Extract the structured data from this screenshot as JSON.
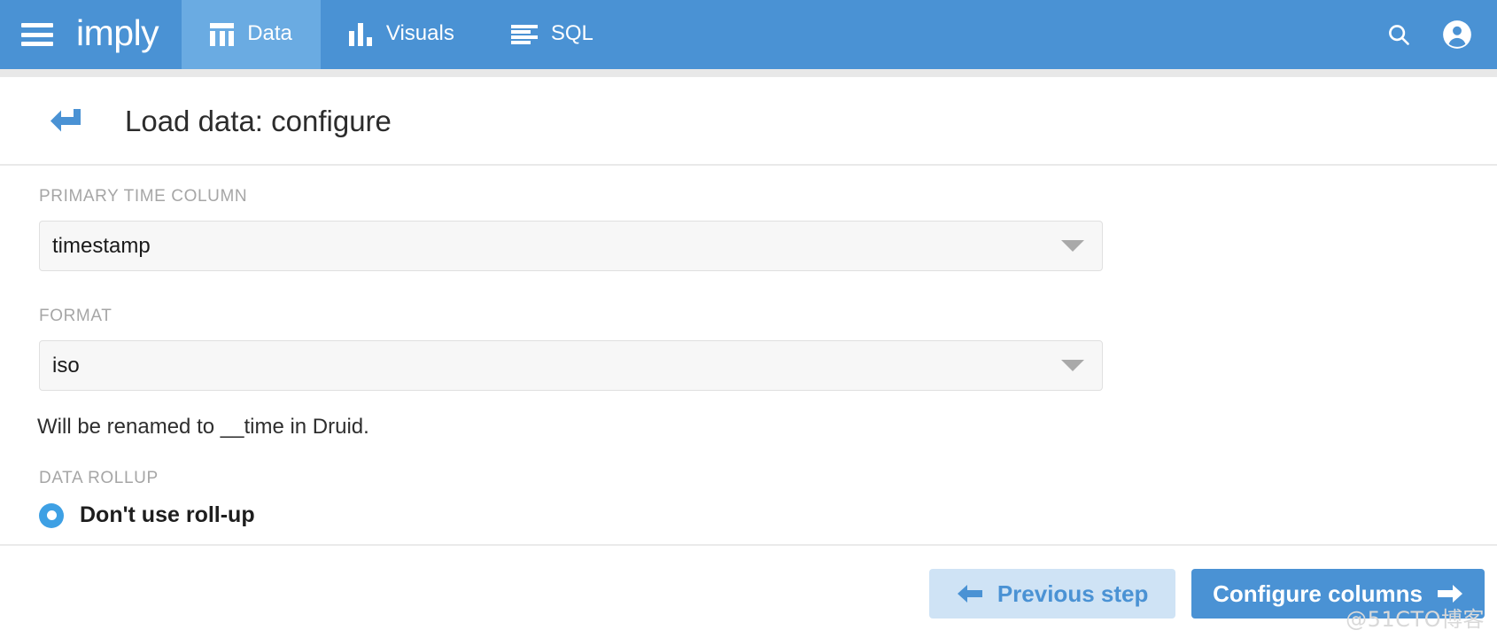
{
  "topbar": {
    "menu_icon": "hamburger-menu-icon",
    "brand": "imply",
    "tabs": [
      {
        "label": "Data",
        "icon": "table-columns-icon",
        "active": true
      },
      {
        "label": "Visuals",
        "icon": "bar-chart-icon",
        "active": false
      },
      {
        "label": "SQL",
        "icon": "text-lines-icon",
        "active": false
      }
    ],
    "actions": [
      {
        "name": "search-icon",
        "label": "Search"
      },
      {
        "name": "account-icon",
        "label": "Account"
      }
    ],
    "background_color": "#4a92d4",
    "active_tab_color": "#6aabe2"
  },
  "page": {
    "back_icon": "back-arrow-icon",
    "title": "Load data: configure"
  },
  "form": {
    "primary_time_column": {
      "label": "PRIMARY TIME COLUMN",
      "value": "timestamp",
      "caret_icon": "chevron-down-icon"
    },
    "format": {
      "label": "FORMAT",
      "value": "iso",
      "caret_icon": "chevron-down-icon"
    },
    "helper_text": "Will be renamed to __time in Druid.",
    "data_rollup": {
      "label": "DATA ROLLUP",
      "option_label": "Don't use roll-up",
      "selected": true,
      "accent_color": "#3ea0e4"
    }
  },
  "footer": {
    "previous_label": "Previous step",
    "previous_icon": "arrow-left-icon",
    "next_label": "Configure columns",
    "next_icon": "arrow-right-icon",
    "secondary_color": "#cfe3f5",
    "primary_color": "#4a92d4"
  },
  "watermark": "@51CTO博客"
}
